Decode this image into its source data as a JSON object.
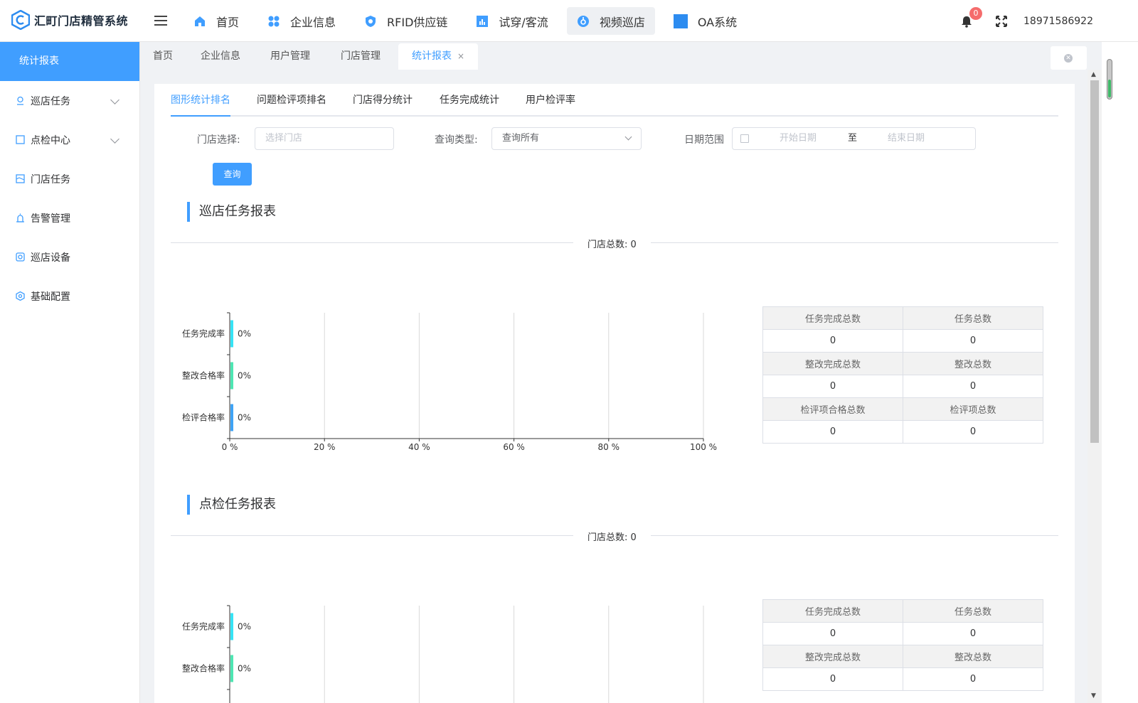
{
  "app": {
    "title": "汇町门店精管系统"
  },
  "topnav": [
    {
      "label": "首页",
      "icon": "home-icon"
    },
    {
      "label": "企业信息",
      "icon": "apps-icon"
    },
    {
      "label": "RFID供应链",
      "icon": "shield-icon"
    },
    {
      "label": "试穿/客流",
      "icon": "bar-chart-icon"
    },
    {
      "label": "视频巡店",
      "icon": "video-icon"
    },
    {
      "label": "OA系统",
      "icon": "square-icon"
    }
  ],
  "header": {
    "notification_count": "0",
    "user_phone": "18971586922"
  },
  "sidebar": {
    "title": "统计报表",
    "items": [
      {
        "label": "巡店任务",
        "expandable": true
      },
      {
        "label": "点检中心",
        "expandable": true
      },
      {
        "label": "门店任务",
        "expandable": false
      },
      {
        "label": "告警管理",
        "expandable": false
      },
      {
        "label": "巡店设备",
        "expandable": false
      },
      {
        "label": "基础配置",
        "expandable": false
      }
    ]
  },
  "tabs": [
    {
      "label": "首页"
    },
    {
      "label": "企业信息"
    },
    {
      "label": "用户管理"
    },
    {
      "label": "门店管理"
    },
    {
      "label": "统计报表",
      "close": "×"
    }
  ],
  "subtabs": [
    "图形统计排名",
    "问题检评项排名",
    "门店得分统计",
    "任务完成统计",
    "用户检评率"
  ],
  "filters": {
    "store_label": "门店选择:",
    "store_placeholder": "选择门店",
    "type_label": "查询类型:",
    "type_value": "查询所有",
    "date_label": "日期范围",
    "start_placeholder": "开始日期",
    "range_sep": "至",
    "end_placeholder": "结束日期",
    "query_button": "查询"
  },
  "section1": {
    "title": "巡店任务报表",
    "store_total": "门店总数:  0",
    "stats": [
      {
        "h1": "任务完成总数",
        "h2": "任务总数",
        "v1": "0",
        "v2": "0"
      },
      {
        "h1": "整改完成总数",
        "h2": "整改总数",
        "v1": "0",
        "v2": "0"
      },
      {
        "h1": "检评项合格总数",
        "h2": "检评项总数",
        "v1": "0",
        "v2": "0"
      }
    ]
  },
  "section2": {
    "title": "点检任务报表",
    "store_total": "门店总数:  0",
    "stats": [
      {
        "h1": "任务完成总数",
        "h2": "任务总数",
        "v1": "0",
        "v2": "0"
      },
      {
        "h1": "整改完成总数",
        "h2": "整改总数",
        "v1": "0",
        "v2": "0"
      }
    ]
  },
  "chart_data": [
    {
      "type": "bar",
      "orientation": "horizontal",
      "categories": [
        "任务完成率",
        "整改合格率",
        "检评合格率"
      ],
      "values": [
        0,
        0,
        0
      ],
      "value_labels": [
        "0%",
        "0%",
        "0%"
      ],
      "colors": [
        "#36e3f5",
        "#4ee6b3",
        "#3fa3f5"
      ],
      "xlim": [
        0,
        100
      ],
      "xticks": [
        "0 %",
        "20 %",
        "40 %",
        "60 %",
        "80 %",
        "100 %"
      ],
      "grid": true
    },
    {
      "type": "bar",
      "orientation": "horizontal",
      "categories": [
        "任务完成率",
        "整改合格率"
      ],
      "values": [
        0,
        0
      ],
      "value_labels": [
        "0%",
        "0%"
      ],
      "colors": [
        "#36e3f5",
        "#4ee6b3"
      ],
      "xlim": [
        0,
        100
      ],
      "grid": true
    }
  ]
}
